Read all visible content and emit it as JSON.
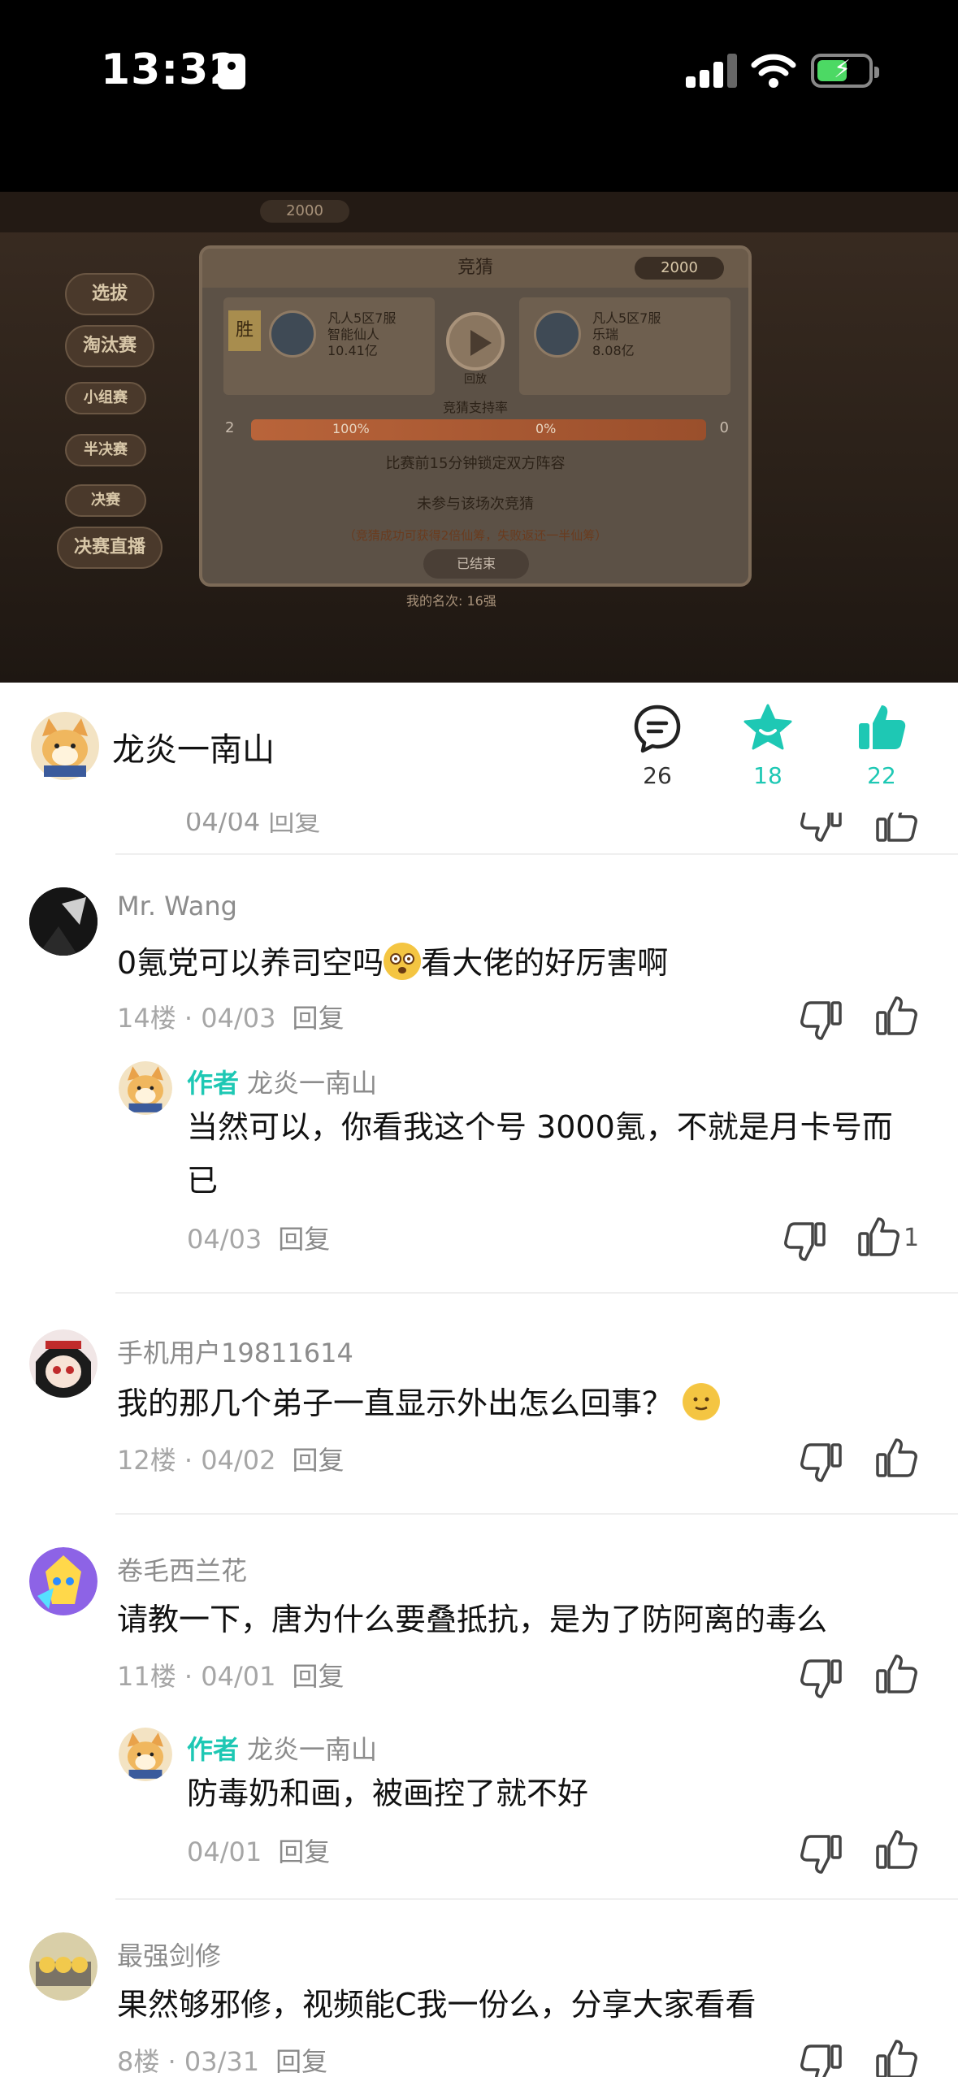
{
  "status_bar": {
    "time": "13:32"
  },
  "video": {
    "dialog_title": "竞猜",
    "coin": "2000",
    "top_coin": "2000",
    "left_team": {
      "server": "凡人5区7服",
      "name": "智能仙人",
      "power": "10.41亿"
    },
    "right_team": {
      "server": "凡人5区7服",
      "name": "乐瑞",
      "power": "8.08亿"
    },
    "rate_label": "竞猜支持率",
    "left_pct": "100%",
    "right_pct": "0%",
    "left_count": "2",
    "right_count": "0",
    "lock_text": "比赛前15分钟锁定双方阵容",
    "not_joined": "未参与该场次竞猜",
    "reward_note": "（竞猜成功可获得2倍仙筹，失败返还一半仙筹）",
    "ended": "已结束",
    "replay": "回放",
    "win": "胜",
    "sidebar": [
      "选拔",
      "淘汰赛",
      "小组赛",
      "半决赛",
      "决赛",
      "决赛直播"
    ],
    "my_rank": "我的名次: 16强"
  },
  "author": {
    "name": "龙炎一南山",
    "comments": "26",
    "favorites": "18",
    "likes": "22",
    "accent": "#1ec8b4"
  },
  "partial_top": {
    "meta": "04/04  回复"
  },
  "comments": [
    {
      "user": "Mr.  Wang",
      "text_a": "0氪党可以养司空吗",
      "text_b": "看大佬的好厉害啊",
      "floor": "14楼 · 04/03",
      "reply": "回复",
      "author_reply": {
        "tag": "作者",
        "user": "龙炎一南山",
        "text": "当然可以，你看我这个号 3000氪，不就是月卡号而已",
        "date": "04/03",
        "reply": "回复",
        "likes": "1"
      }
    },
    {
      "user": "手机用户19811614",
      "text": "我的那几个弟子一直显示外出怎么回事？",
      "floor": "12楼 · 04/02",
      "reply": "回复"
    },
    {
      "user": "卷毛西兰花",
      "text": "请教一下，唐为什么要叠抵抗，是为了防阿离的毒么",
      "floor": "11楼 · 04/01",
      "reply": "回复",
      "author_reply": {
        "tag": "作者",
        "user": "龙炎一南山",
        "text": "防毒奶和画，被画控了就不好",
        "date": "04/01",
        "reply": "回复"
      }
    },
    {
      "user": "最强剑修",
      "text": "果然够邪修，视频能C我一份么，分享大家看看",
      "floor": "8楼 · 03/31",
      "reply": "回复"
    }
  ]
}
